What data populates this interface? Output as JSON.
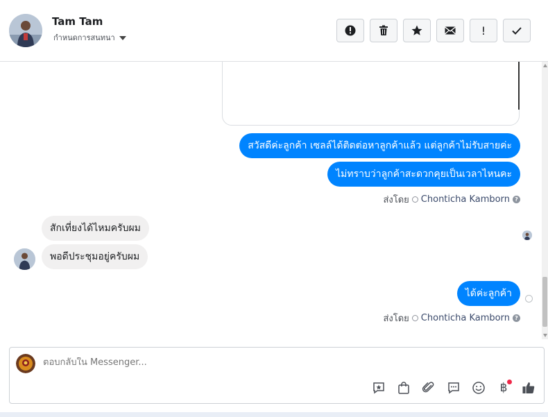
{
  "header": {
    "name": "Tam Tam",
    "subtitle": "กำหนดการสนทนา",
    "toolbar_icons": [
      "report-icon",
      "trash-icon",
      "star-icon",
      "mail-icon",
      "exclamation-icon",
      "check-icon"
    ],
    "toolbar_exclamation": "!"
  },
  "messages": {
    "outgoing_1": "สวัสดีค่ะลูกค้า เซลล์ได้ติดต่อหาลูกค้าแล้ว แต่ลูกค้าไม่รับสายค่ะ",
    "outgoing_2": "ไม่ทราบว่าลูกค้าสะดวกคุยเป็นเวลาไหนคะ",
    "sent_by_1": {
      "prefix": "ส่งโดย",
      "agent": "Chonticha Kamborn",
      "help": "?"
    },
    "incoming_1": "สักเที่ยงได้ไหมครับผม",
    "incoming_2": "พอดีประชุมอยู่ครับผม",
    "outgoing_3": "ได้ค่ะลูกค้า",
    "sent_by_2": {
      "prefix": "ส่งโดย",
      "agent": "Chonticha Kamborn",
      "help": "?"
    }
  },
  "composer": {
    "placeholder": "ตอบกลับใน Messenger...",
    "baht_symbol": "฿"
  },
  "colors": {
    "accent": "#0084ff",
    "incoming_bubble": "#f1f0f0",
    "notification": "#f02849"
  }
}
